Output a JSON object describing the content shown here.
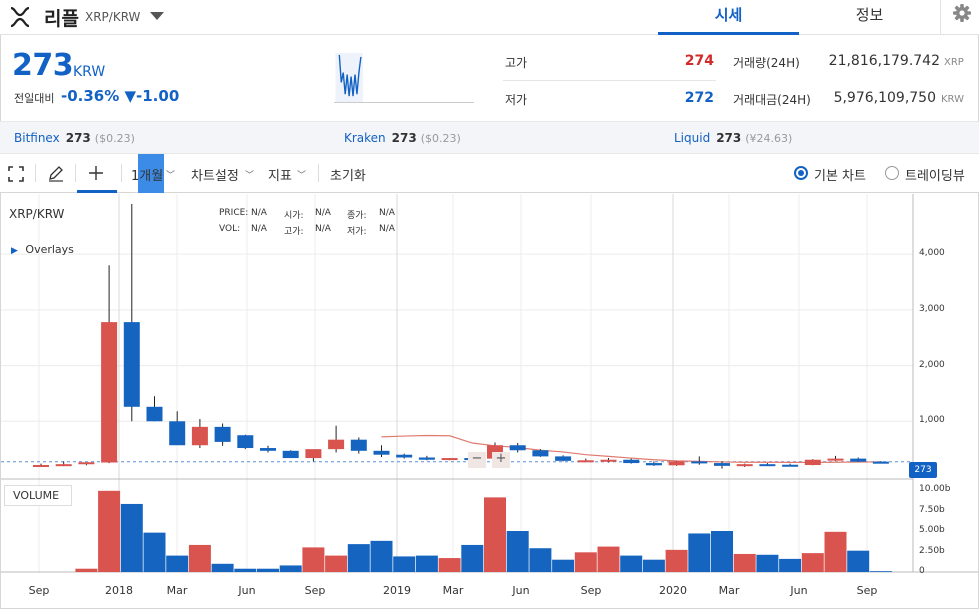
{
  "header": {
    "coin_name": "리플",
    "pair": "XRP/KRW",
    "tab_market": "시세",
    "tab_info": "정보"
  },
  "price": {
    "current": "273",
    "unit": "KRW",
    "change_label": "전일대비",
    "change_value": "-0.36% ▼-1.00"
  },
  "stats": {
    "high_label": "고가",
    "high_value": "274",
    "low_label": "저가",
    "low_value": "272",
    "volume_label": "거래량(24H)",
    "volume_value": "21,816,179.742",
    "volume_unit": "XRP",
    "amount_label": "거래대금(24H)",
    "amount_value": "5,976,109,750",
    "amount_unit": "KRW"
  },
  "exchanges": [
    {
      "name": "Bitfinex",
      "price": "273",
      "sub": "($0.23)"
    },
    {
      "name": "Kraken",
      "price": "273",
      "sub": "($0.23)"
    },
    {
      "name": "Liquid",
      "price": "273",
      "sub": "(¥24.63)"
    }
  ],
  "toolbar": {
    "period": "1개월",
    "chart_settings": "차트설정",
    "indicators": "지표",
    "reset": "초기화",
    "basic_chart": "기본 차트",
    "tradingview": "트레이딩뷰"
  },
  "chart": {
    "title": "XRP/KRW",
    "overlays": "Overlays",
    "ohlc": {
      "price_label": "PRICE:",
      "price": "N/A",
      "open_label": "시가:",
      "open": "N/A",
      "close_label": "종가:",
      "close": "N/A",
      "vol_label": "VOL:",
      "vol": "N/A",
      "high_label": "고가:",
      "high": "N/A",
      "low_label": "저가:",
      "low": "N/A"
    },
    "volume_tag": "VOLUME",
    "last_price": "273",
    "zoom_out": "−",
    "zoom_in": "+",
    "accent": "#1261c4",
    "up_color": "#d9534f",
    "down_color": "#1565c0"
  },
  "chart_data": {
    "type": "candlestick",
    "x": [
      "2017-09",
      "2017-10",
      "2017-11",
      "2017-12",
      "2018-01",
      "2018-02",
      "2018-03",
      "2018-04",
      "2018-05",
      "2018-06",
      "2018-07",
      "2018-08",
      "2018-09",
      "2018-10",
      "2018-11",
      "2018-12",
      "2019-01",
      "2019-02",
      "2019-03",
      "2019-04",
      "2019-05",
      "2019-06",
      "2019-07",
      "2019-08",
      "2019-09",
      "2019-10",
      "2019-11",
      "2019-12",
      "2020-01",
      "2020-02",
      "2020-03",
      "2020-04",
      "2020-05",
      "2020-06",
      "2020-07",
      "2020-08",
      "2020-09",
      "2020-10"
    ],
    "open": [
      205,
      215,
      230,
      260,
      2780,
      1260,
      1000,
      570,
      900,
      750,
      520,
      470,
      340,
      500,
      670,
      470,
      400,
      350,
      310,
      340,
      330,
      570,
      480,
      370,
      290,
      300,
      310,
      250,
      210,
      280,
      250,
      200,
      230,
      220,
      215,
      310,
      330,
      275
    ],
    "high": [
      240,
      280,
      260,
      3800,
      4900,
      1450,
      1180,
      1040,
      960,
      760,
      560,
      480,
      390,
      920,
      710,
      570,
      420,
      380,
      340,
      380,
      620,
      610,
      500,
      390,
      330,
      340,
      330,
      280,
      290,
      370,
      280,
      240,
      250,
      240,
      320,
      380,
      350,
      285
    ],
    "low": [
      185,
      195,
      210,
      250,
      1000,
      1000,
      580,
      520,
      560,
      500,
      440,
      380,
      280,
      440,
      420,
      360,
      330,
      300,
      300,
      290,
      320,
      440,
      360,
      280,
      270,
      260,
      240,
      200,
      200,
      220,
      150,
      180,
      200,
      195,
      210,
      290,
      270,
      270
    ],
    "close": [
      215,
      230,
      265,
      2780,
      1260,
      1000,
      570,
      900,
      630,
      520,
      470,
      340,
      500,
      670,
      470,
      400,
      350,
      310,
      340,
      330,
      570,
      480,
      370,
      290,
      300,
      310,
      250,
      210,
      280,
      250,
      200,
      230,
      220,
      215,
      310,
      330,
      275,
      273
    ],
    "volume": [
      0,
      0,
      0.4,
      9.9,
      8.3,
      4.8,
      2.0,
      3.3,
      1.0,
      0.4,
      0.4,
      0.8,
      3.0,
      2.0,
      3.4,
      3.8,
      1.9,
      2.0,
      1.7,
      3.3,
      9.1,
      5.0,
      2.9,
      1.5,
      2.4,
      3.1,
      2.0,
      1.5,
      2.7,
      4.7,
      5.0,
      2.2,
      2.1,
      1.6,
      2.3,
      4.9,
      2.6,
      0.1
    ],
    "overlay_line": {
      "x": [
        "2018-12",
        "2019-01",
        "2019-02",
        "2019-03",
        "2019-04",
        "2019-05",
        "2019-06",
        "2019-07",
        "2019-08",
        "2019-09",
        "2019-10",
        "2019-11",
        "2019-12",
        "2020-01",
        "2020-02",
        "2020-03",
        "2020-04",
        "2020-05",
        "2020-06",
        "2020-07",
        "2020-08",
        "2020-09",
        "2020-10"
      ],
      "y": [
        720,
        735,
        745,
        740,
        610,
        560,
        530,
        480,
        450,
        400,
        370,
        340,
        310,
        290,
        280,
        270,
        265,
        265,
        262,
        263,
        265,
        268,
        270
      ]
    },
    "y_ticks": [
      "1,000",
      "2,000",
      "3,000",
      "4,000"
    ],
    "y_range": [
      0,
      4900
    ],
    "vol_ticks": [
      "0",
      "2.50b",
      "5.00b",
      "7.50b",
      "10.00b"
    ],
    "vol_range": [
      0,
      10
    ],
    "x_ticks": [
      "Sep",
      "2018",
      "Mar",
      "Jun",
      "Sep",
      "2019",
      "Mar",
      "Jun",
      "Sep",
      "2020",
      "Mar",
      "Jun",
      "Sep"
    ],
    "last_price": 273
  }
}
